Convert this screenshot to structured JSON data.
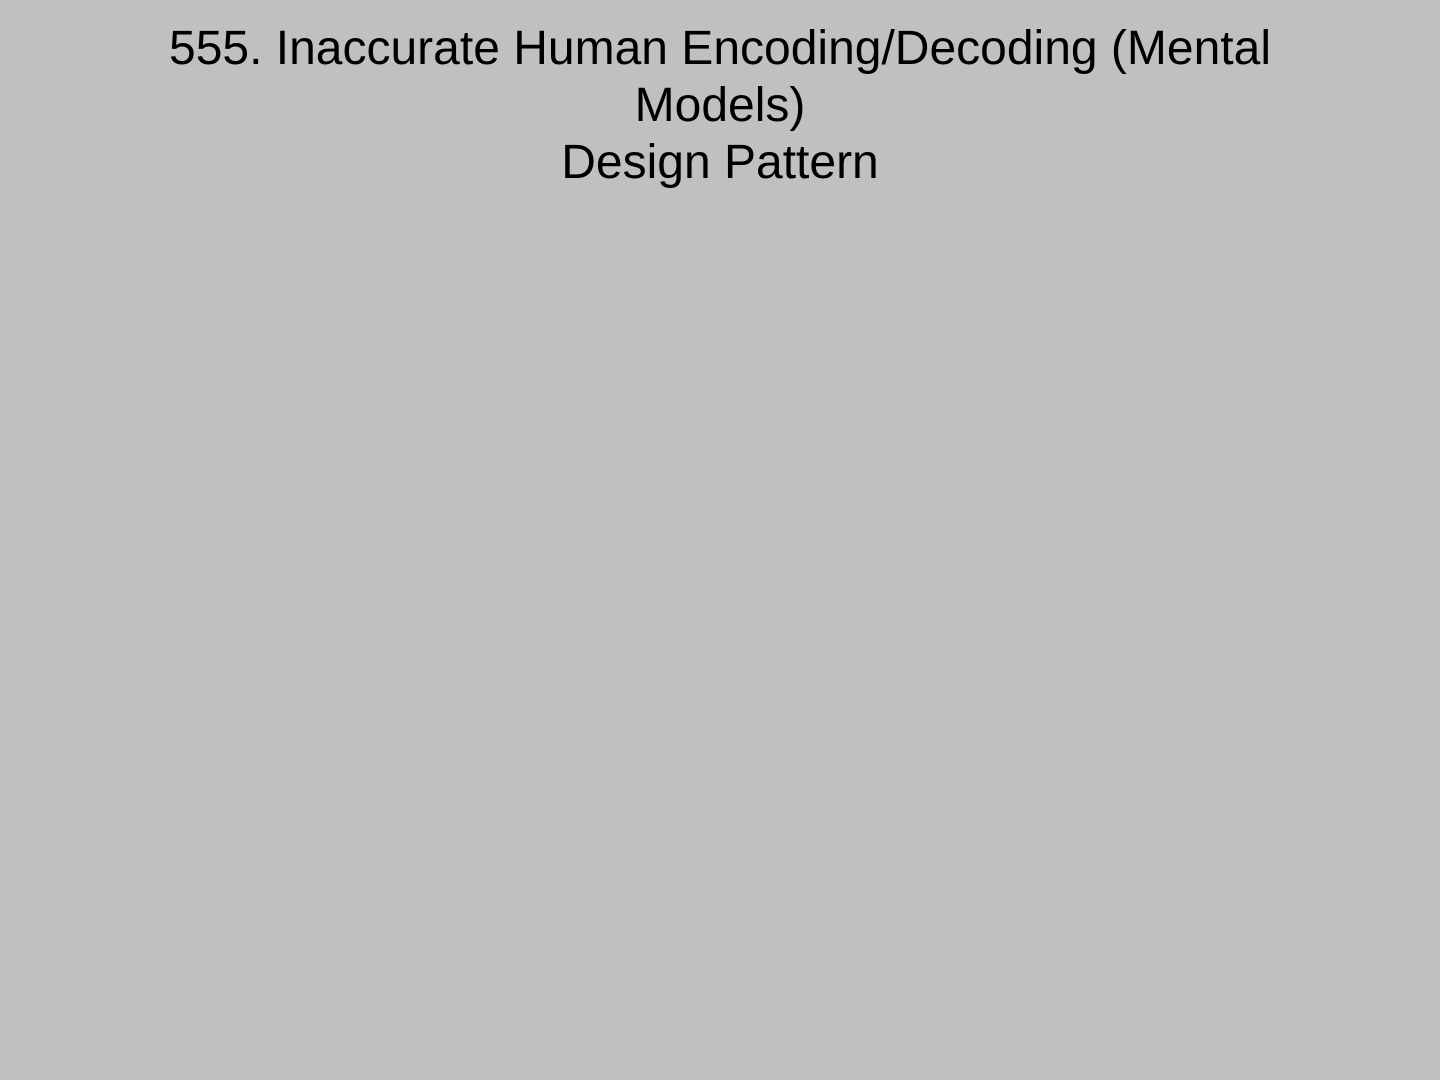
{
  "slide": {
    "title_lines": [
      "555. Inaccurate Human Encoding/Decoding (Mental",
      "Models)",
      "Design Pattern"
    ],
    "background_color": "#c0c0c0",
    "text_color": "#000000"
  }
}
